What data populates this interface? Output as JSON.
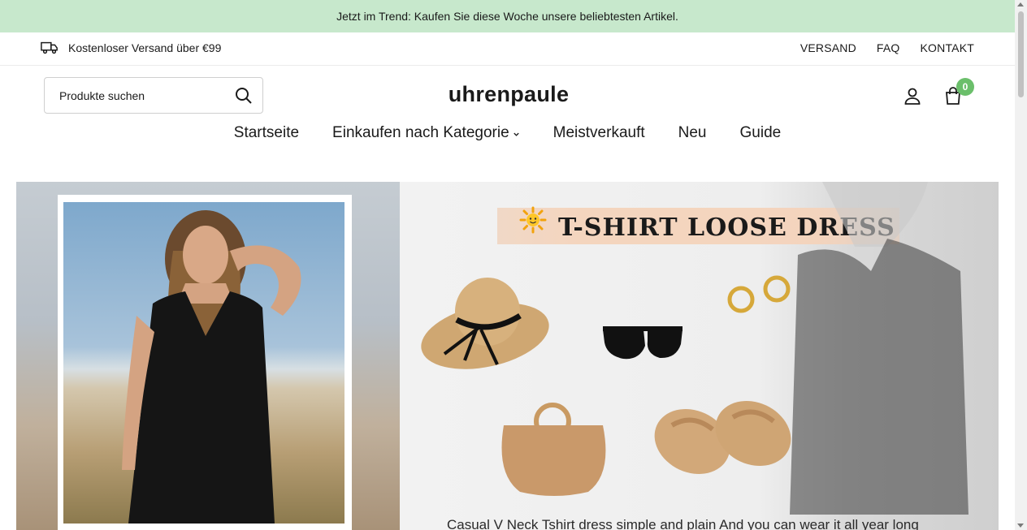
{
  "announcement": "Jetzt im Trend: Kaufen Sie diese Woche unsere beliebtesten Artikel.",
  "topbar": {
    "shipping_text": "Kostenloser Versand über €99",
    "links": [
      "VERSAND",
      "FAQ",
      "KONTAKT"
    ]
  },
  "header": {
    "search_placeholder": "Produkte suchen",
    "logo": "uhrenpaule",
    "cart_count": "0"
  },
  "nav": {
    "items": [
      "Startseite",
      "Einkaufen nach Kategorie",
      "Meistverkauft",
      "Neu",
      "Guide"
    ]
  },
  "hero": {
    "title": "T-SHIRT LOOSE DRESS",
    "caption": "Casual  V Neck Tshirt dress simple and plain And you can wear it all year long"
  },
  "colors": {
    "announcement_bg": "#c7e8cc",
    "badge": "#6bbf6b"
  },
  "icons": [
    "truck-icon",
    "search-icon",
    "account-icon",
    "cart-icon",
    "chevron-down-icon",
    "sun-icon"
  ]
}
